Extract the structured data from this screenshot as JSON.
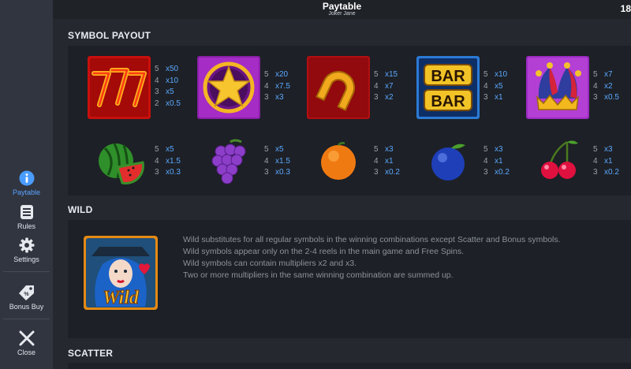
{
  "header": {
    "title": "Paytable",
    "subtitle": "Joker Jane",
    "right_value": "18"
  },
  "nav": {
    "paytable": "Paytable",
    "rules": "Rules",
    "settings": "Settings",
    "bonus_buy": "Bonus Buy",
    "close": "Close"
  },
  "sections": {
    "symbol_payout": "SYMBOL PAYOUT",
    "wild": "WILD",
    "scatter": "SCATTER"
  },
  "symbols_top": [
    {
      "name": "sevens",
      "pays": [
        {
          "count": "5",
          "mult": "x50"
        },
        {
          "count": "4",
          "mult": "x10"
        },
        {
          "count": "3",
          "mult": "x5"
        },
        {
          "count": "2",
          "mult": "x0.5"
        }
      ]
    },
    {
      "name": "star",
      "pays": [
        {
          "count": "5",
          "mult": "x20"
        },
        {
          "count": "4",
          "mult": "x7.5"
        },
        {
          "count": "3",
          "mult": "x3"
        }
      ]
    },
    {
      "name": "horseshoe",
      "pays": [
        {
          "count": "5",
          "mult": "x15"
        },
        {
          "count": "4",
          "mult": "x7"
        },
        {
          "count": "3",
          "mult": "x2"
        }
      ]
    },
    {
      "name": "bar",
      "pays": [
        {
          "count": "5",
          "mult": "x10"
        },
        {
          "count": "4",
          "mult": "x5"
        },
        {
          "count": "3",
          "mult": "x1"
        }
      ]
    },
    {
      "name": "jester-hat",
      "pays": [
        {
          "count": "5",
          "mult": "x7"
        },
        {
          "count": "4",
          "mult": "x2"
        },
        {
          "count": "3",
          "mult": "x0.5"
        }
      ]
    }
  ],
  "symbols_bottom": [
    {
      "name": "watermelon",
      "pays": [
        {
          "count": "5",
          "mult": "x5"
        },
        {
          "count": "4",
          "mult": "x1.5"
        },
        {
          "count": "3",
          "mult": "x0.3"
        }
      ]
    },
    {
      "name": "grapes",
      "pays": [
        {
          "count": "5",
          "mult": "x5"
        },
        {
          "count": "4",
          "mult": "x1.5"
        },
        {
          "count": "3",
          "mult": "x0.3"
        }
      ]
    },
    {
      "name": "orange",
      "pays": [
        {
          "count": "5",
          "mult": "x3"
        },
        {
          "count": "4",
          "mult": "x1"
        },
        {
          "count": "3",
          "mult": "x0.2"
        }
      ]
    },
    {
      "name": "plum",
      "pays": [
        {
          "count": "5",
          "mult": "x3"
        },
        {
          "count": "4",
          "mult": "x1"
        },
        {
          "count": "3",
          "mult": "x0.2"
        }
      ]
    },
    {
      "name": "cherries",
      "pays": [
        {
          "count": "5",
          "mult": "x3"
        },
        {
          "count": "4",
          "mult": "x1"
        },
        {
          "count": "3",
          "mult": "x0.2"
        }
      ]
    }
  ],
  "symbol_text": {
    "bar_top": "BAR",
    "bar_bottom": "BAR",
    "wild_logo": "Wild"
  },
  "wild_text": [
    "Wild substitutes for all regular symbols in the winning combinations except Scatter and Bonus symbols.",
    "Wild symbols appear only on the 2-4 reels in the main game and Free Spins.",
    "Wild symbols can contain multipliers x2 and x3.",
    "Two or more multipliers in the same winning combination are summed up."
  ],
  "colors": {
    "accent": "#5aa8ff",
    "panel": "#1d2026",
    "background": "#25282f",
    "sidebar": "#31353f"
  }
}
